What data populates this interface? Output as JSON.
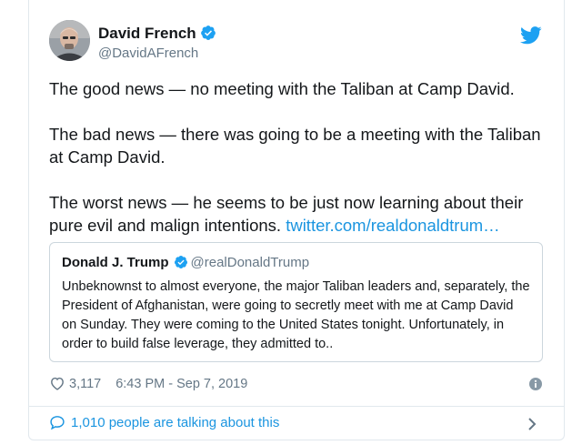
{
  "author": {
    "name": "David French",
    "handle": "@DavidAFrench",
    "verified": true
  },
  "tweet": {
    "paragraphs": [
      "The good news — no meeting with the Taliban at Camp David.",
      "The bad news — there was going to be a meeting with the Taliban at Camp David."
    ],
    "last_paragraph_text": "The worst news — he seems to be just now learning about their pure evil and malign intentions. ",
    "link_text": "twitter.com/realdonaldtrum…"
  },
  "quoted_tweet": {
    "name": "Donald J. Trump",
    "handle": "@realDonaldTrump",
    "verified": true,
    "text": "Unbeknownst to almost everyone, the major Taliban leaders and, separately, the President of Afghanistan, were going to secretly meet with me at Camp David on Sunday. They were coming to the United States tonight. Unfortunately, in order to build false leverage, they admitted to.."
  },
  "meta": {
    "like_count": "3,117",
    "timestamp": "6:43 PM - Sep 7, 2019"
  },
  "conversation": {
    "label": "1,010 people are talking about this"
  },
  "icons": {
    "like": "heart-outline-icon",
    "info": "info-circle-icon",
    "reply": "speech-bubble-icon",
    "chevron": "chevron-right-icon",
    "brand": "twitter-bird-icon",
    "verified": "verified-badge-icon"
  },
  "colors": {
    "link": "#1b95e0",
    "secondary_text": "#657786",
    "primary_text": "#14171a",
    "verified": "#1da1f2",
    "border": "#e1e8ed"
  }
}
